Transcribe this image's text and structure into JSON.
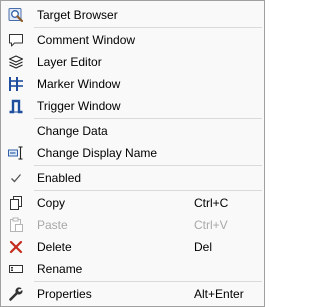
{
  "menu": {
    "items": [
      {
        "label": "Target Browser",
        "icon": "target-browser-icon"
      },
      {
        "label": "Comment Window",
        "icon": "comment-window-icon"
      },
      {
        "label": "Layer Editor",
        "icon": "layer-editor-icon"
      },
      {
        "label": "Marker Window",
        "icon": "marker-window-icon"
      },
      {
        "label": "Trigger Window",
        "icon": "trigger-window-icon"
      },
      {
        "label": "Change Data"
      },
      {
        "label": "Change Display Name",
        "icon": "rename-cursor-icon"
      },
      {
        "label": "Enabled",
        "icon": "checkmark-icon",
        "checked": true
      },
      {
        "label": "Copy",
        "shortcut": "Ctrl+C",
        "icon": "copy-icon"
      },
      {
        "label": "Paste",
        "shortcut": "Ctrl+V",
        "icon": "paste-icon",
        "disabled": true
      },
      {
        "label": "Delete",
        "shortcut": "Del",
        "icon": "delete-x-icon"
      },
      {
        "label": "Rename",
        "icon": "rename-icon"
      },
      {
        "label": "Properties",
        "shortcut": "Alt+Enter",
        "icon": "wrench-icon"
      }
    ]
  },
  "colors": {
    "background": "#f9f9f9",
    "border": "#a0a0a0",
    "separator": "#dadada",
    "disabled_text": "#a8a8a8",
    "delete_icon": "#c42b1c",
    "accent_blue": "#1f4e9e"
  }
}
